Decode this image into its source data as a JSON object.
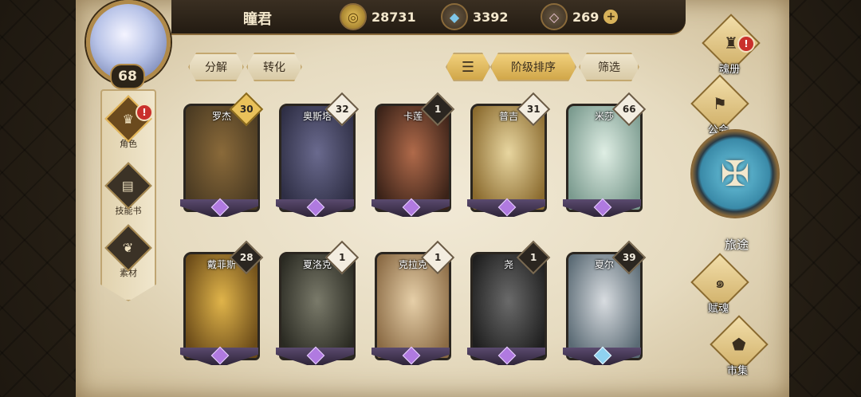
{
  "player": {
    "name": "瞳君",
    "level": "68"
  },
  "resources": [
    {
      "icon": "coin-icon",
      "value": "28731"
    },
    {
      "icon": "crystal-icon",
      "value": "3392"
    },
    {
      "icon": "pink-gem-icon",
      "value": "269"
    }
  ],
  "sidebar": {
    "items": [
      {
        "label": "角色",
        "icon": "character-icon",
        "alert": "!"
      },
      {
        "label": "技能书",
        "icon": "skill-book-icon"
      },
      {
        "label": "素材",
        "icon": "material-icon"
      }
    ]
  },
  "toolbar": {
    "decompose": "分解",
    "convert": "转化",
    "sort_by_tier": "阶级排序",
    "filter": "筛选"
  },
  "cards": [
    {
      "name": "罗杰",
      "level": "30",
      "style": "gold",
      "colors": [
        "#8a6a3a",
        "#4a3a22"
      ],
      "gem": "purple"
    },
    {
      "name": "奥斯塔",
      "level": "32",
      "style": "light",
      "colors": [
        "#6a6a8e",
        "#2e2e44"
      ],
      "gem": "purple"
    },
    {
      "name": "卡莲",
      "level": "1",
      "style": "dark",
      "colors": [
        "#b06a4a",
        "#3a2218"
      ],
      "gem": "purple"
    },
    {
      "name": "普吉",
      "level": "31",
      "style": "light",
      "colors": [
        "#e8d6a0",
        "#8a6a2e"
      ],
      "gem": "purple"
    },
    {
      "name": "米莎",
      "level": "66",
      "style": "light",
      "colors": [
        "#dfeee4",
        "#7a9a8e"
      ],
      "gem": "purple"
    },
    {
      "name": "戴菲斯",
      "level": "28",
      "style": "dark",
      "colors": [
        "#e0b44a",
        "#6a4a18"
      ],
      "gem": "purple"
    },
    {
      "name": "夏洛克",
      "level": "1",
      "style": "light",
      "colors": [
        "#7a7a6a",
        "#2a2a22"
      ],
      "gem": "purple"
    },
    {
      "name": "克拉克",
      "level": "1",
      "style": "light",
      "colors": [
        "#e6cfa8",
        "#8a6a44"
      ],
      "gem": "purple"
    },
    {
      "name": "尧",
      "level": "1",
      "style": "dark",
      "colors": [
        "#6a6a6a",
        "#1e1e1e"
      ],
      "gem": "purple"
    },
    {
      "name": "夏尔",
      "level": "39",
      "style": "dark",
      "colors": [
        "#d8dce0",
        "#5a6a74"
      ],
      "gem": "blue"
    }
  ],
  "right_nav": {
    "soul_book": {
      "label": "魂册",
      "alert": "!"
    },
    "guild": {
      "label": "公会"
    },
    "journey": {
      "label": "旅途"
    },
    "soul_endow": {
      "label": "赋魂"
    },
    "market": {
      "label": "市集"
    }
  }
}
